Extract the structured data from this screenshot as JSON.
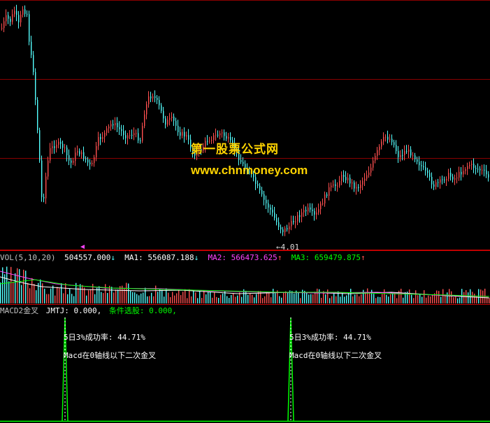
{
  "watermark": {
    "line1": "第一股票公式网",
    "line2": "www.chnmoney.com"
  },
  "price_panel": {
    "low_label": "←4.01"
  },
  "vol_panel": {
    "name": "VOL(5,10,20)",
    "vol_value": "504557.000",
    "vol_arrow": "↓",
    "ma1_label": "MA1:",
    "ma1_value": "556087.188",
    "ma1_arrow": "↓",
    "ma2_label": "MA2:",
    "ma2_value": "566473.625",
    "ma2_arrow": "↑",
    "ma3_label": "MA3:",
    "ma3_value": "659479.875",
    "ma3_arrow": "↑"
  },
  "macd_panel": {
    "name": "MACD2金叉",
    "jmtj_label": "JMTJ:",
    "jmtj_value": "0.000,",
    "select_label": "条件选股:",
    "select_value": "0.000,",
    "signals": [
      {
        "rate": "5日3%成功率: 44.71%",
        "desc": "Macd在0轴线以下二次金叉"
      },
      {
        "rate": "5日3%成功率: 44.71%",
        "desc": "Macd在0轴线以下二次金叉"
      }
    ]
  },
  "colors": {
    "up": "#ff5050",
    "down": "#54ffff",
    "grid": "#8a0000",
    "ma1": "#ffffff",
    "ma2": "#ff44ff",
    "ma3": "#00ff00",
    "signal": "#00ff00"
  }
}
